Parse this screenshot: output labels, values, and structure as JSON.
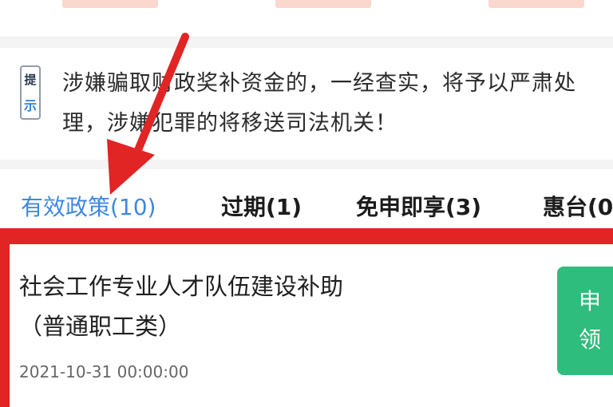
{
  "notice": {
    "badge_line1": "提",
    "badge_line2": "示",
    "line1": "涉嫌骗取财政奖补资金的，一经查实，将予以严肃处",
    "line2": "理，涉嫌犯罪的将移送司法机关！"
  },
  "tabs": [
    {
      "label": "有效政策(10)",
      "active": true
    },
    {
      "label": "过期(1)",
      "active": false
    },
    {
      "label": "免申即享(3)",
      "active": false
    },
    {
      "label": "惠台(0",
      "active": false
    }
  ],
  "policy_card": {
    "title_line1": "社会工作专业人才队伍建设补助",
    "title_line2": "（普通职工类）",
    "date": "2021-10-31 00:00:00",
    "apply_line1": "申",
    "apply_line2": "领"
  },
  "colors": {
    "active_tab": "#3f88dd",
    "annotation_red": "#e12424",
    "apply_green": "#2fbd7d"
  },
  "icons": {
    "annotation": "arrow-down-left-icon",
    "notice": "notice-badge-icon"
  }
}
